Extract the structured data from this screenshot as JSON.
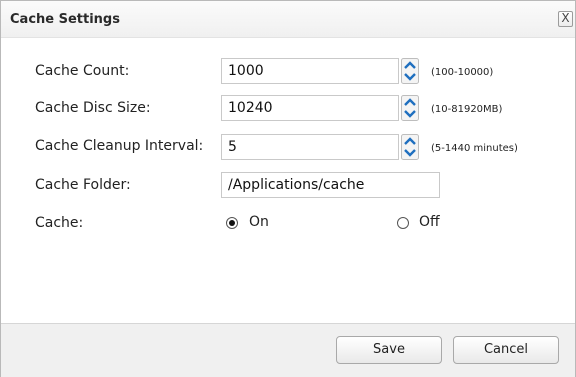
{
  "dialog": {
    "title": "Cache Settings",
    "close_label": "X"
  },
  "form": {
    "cache_count": {
      "label": "Cache Count:",
      "value": "1000",
      "hint": "(100-10000)"
    },
    "cache_disc_size": {
      "label": "Cache Disc Size:",
      "value": "10240",
      "hint": "(10-81920MB)"
    },
    "cache_cleanup_interval": {
      "label": "Cache Cleanup Interval:",
      "value": "5",
      "hint": "(5-1440 minutes)"
    },
    "cache_folder": {
      "label": "Cache Folder:",
      "value": "/Applications/cache"
    },
    "cache": {
      "label": "Cache:",
      "on_label": "On",
      "off_label": "Off",
      "selected": "On"
    }
  },
  "footer": {
    "save_label": "Save",
    "cancel_label": "Cancel"
  },
  "colors": {
    "spinner_arrow": "#1f6fbf",
    "footer_bg": "#f0f0f0"
  }
}
